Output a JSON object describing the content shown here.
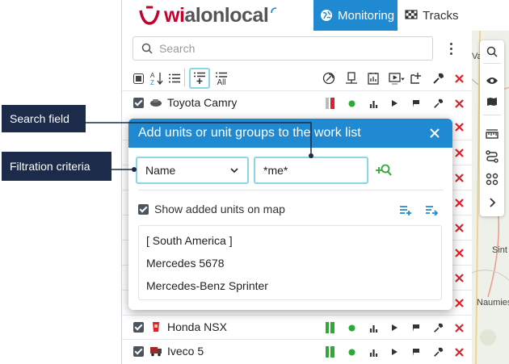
{
  "header": {
    "logo_text_a": "wi",
    "logo_text_b": "alonlocal",
    "tab_monitoring": "Monitoring",
    "tab_tracks": "Tracks"
  },
  "search": {
    "placeholder": "Search"
  },
  "toolbar": {
    "all_label": "All"
  },
  "rows": [
    {
      "name": "Toyota Camry"
    },
    {
      "name": "Honda NSX"
    },
    {
      "name": "Iveco 5"
    }
  ],
  "dialog": {
    "title": "Add units or unit groups to the work list",
    "filter_value": "Name",
    "search_value": "*me*",
    "show_on_map_label": "Show added units on map",
    "results": [
      "[ South America ]",
      "Mercedes 5678",
      "Mercedes-Benz Sprinter"
    ]
  },
  "callouts": {
    "search_field": "Search field",
    "filtration": "Filtration criteria"
  },
  "map_labels": [
    "Va",
    "Sint",
    "Naumiest"
  ],
  "colors": {
    "accent": "#1f8ad1",
    "status_green": "#2ea836",
    "action_red": "#e0202a",
    "callout_bg": "#1b2b49",
    "field_border": "#8ad6e8"
  }
}
